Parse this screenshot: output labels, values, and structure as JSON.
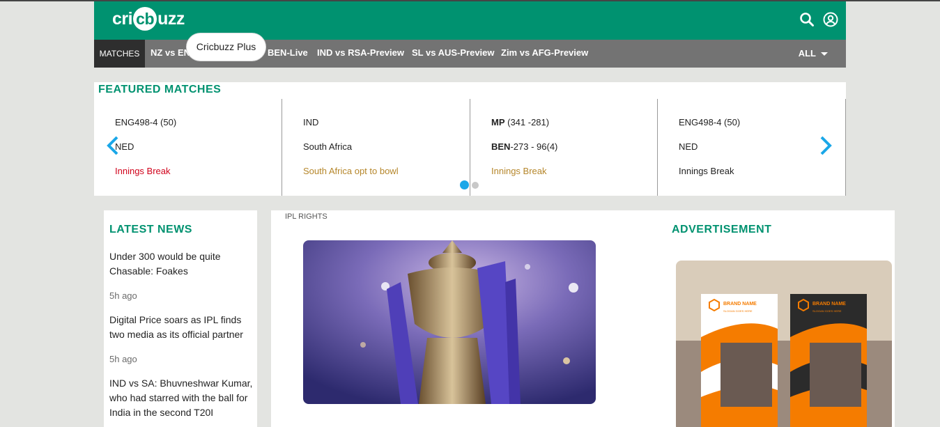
{
  "brand": {
    "logo_pre": "cri",
    "logo_mid": "cb",
    "logo_post": "uzz"
  },
  "header": {
    "search_icon": "search-icon",
    "account_icon": "user-circle-icon"
  },
  "nav": {
    "matches_label": "MATCHES",
    "items": [
      "NZ vs ENG",
      "BEN-Live",
      "IND vs RSA-Preview",
      "SL vs AUS-Preview",
      "Zim vs AFG-Preview"
    ],
    "all_label": "ALL"
  },
  "tooltip": "Cricbuzz Plus",
  "featured": {
    "title": "FEATURED MATCHES",
    "cards": [
      {
        "line1": "ENG498-4 (50)",
        "line2": "NED",
        "status": "Innings Break"
      },
      {
        "line1": "IND",
        "line2": "South Africa",
        "status": "South Africa opt to bowl"
      },
      {
        "line1_team": "MP",
        "line1_score": " (341 -281)",
        "line2_team": "BEN",
        "line2_score": "-273 - 96(4)",
        "status": "Innings Break"
      },
      {
        "line1": "ENG498-4 (50)",
        "line2": "NED",
        "status": "Innings Break"
      }
    ],
    "colors": {
      "status_red": "#d0021b",
      "status_amber": "#b5862a",
      "dot_active": "#1aa7e8"
    }
  },
  "news": {
    "title": "LATEST NEWS",
    "items": [
      {
        "headline": "Under 300 would be quite Chasable: Foakes",
        "time": "5h ago"
      },
      {
        "headline": "Digital Price soars as IPL finds two media as its official partner",
        "time": "5h ago"
      },
      {
        "headline": "IND vs SA: Bhuvneshwar Kumar, who had starred with the ball for India in the second T20I"
      }
    ]
  },
  "main": {
    "section_label": "IPL RIGHTS"
  },
  "ad": {
    "title": "ADVERTISEMENT",
    "brand_name": "BRAND NAME",
    "slogan": "SLOGAN GOES HERE"
  },
  "theme": {
    "primary": "#009270",
    "nav_bg": "#737373",
    "page_bg": "#e3e4e1"
  }
}
